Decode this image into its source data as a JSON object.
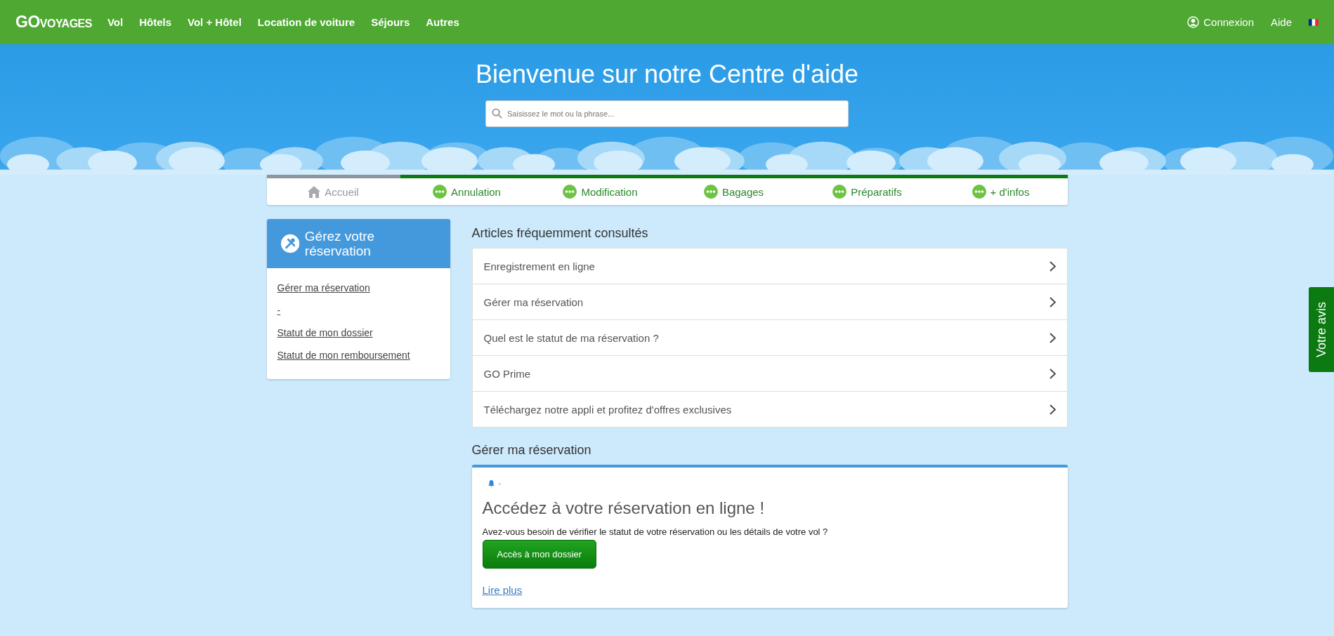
{
  "header": {
    "logo": "**GO**VOYAGES",
    "nav": [
      "Vol",
      "Hôtels",
      "Vol + Hôtel",
      "Location de voiture",
      "Séjours",
      "Autres"
    ],
    "login": "Connexion",
    "help": "Aide"
  },
  "hero": {
    "title": "Bienvenue sur notre Centre d'aide",
    "search": {
      "placeholder": "Saisissez le mot ou la phrase..."
    }
  },
  "tabs": [
    {
      "label": "Accueil",
      "kind": "home",
      "selected": true
    },
    {
      "label": "Annulation",
      "kind": "topic",
      "selected": false
    },
    {
      "label": "Modification",
      "kind": "topic",
      "selected": false
    },
    {
      "label": "Bagages",
      "kind": "topic",
      "selected": false
    },
    {
      "label": "Préparatifs",
      "kind": "topic",
      "selected": false
    },
    {
      "label": "+ d'infos",
      "kind": "topic",
      "selected": false
    }
  ],
  "sidebar": {
    "title": "Gérez votre réservation",
    "links": [
      "Gérer ma réservation",
      "-",
      "Statut de mon dossier",
      "Statut de mon remboursement"
    ]
  },
  "articles": {
    "heading": "Articles fréquemment consultés",
    "items": [
      "Enregistrement en ligne",
      "Gérer ma réservation",
      "Quel est le statut de ma réservation ?",
      "GO Prime",
      "Téléchargez notre appli et profitez d'offres exclusives"
    ]
  },
  "booking": {
    "heading": "Gérer ma réservation",
    "note": "-",
    "title": "Accédez à votre réservation en ligne !",
    "text": "Avez-vous besoin de vérifier le statut de votre réservation ou les détails de votre vol ?",
    "button": "Accès à mon dossier",
    "more": "Lire plus"
  },
  "feedback": "Votre avis"
}
